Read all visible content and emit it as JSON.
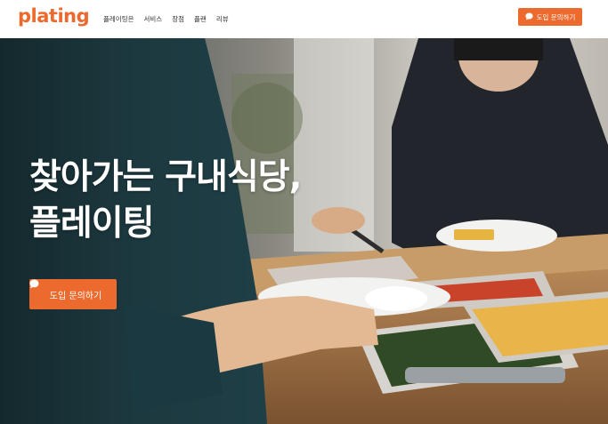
{
  "header": {
    "logo": "plating",
    "nav": [
      {
        "label": "플레이팅은"
      },
      {
        "label": "서비스"
      },
      {
        "label": "장점"
      },
      {
        "label": "플랜"
      },
      {
        "label": "리뷰"
      }
    ],
    "cta_label": "도입 문의하기"
  },
  "hero": {
    "title_line1": "찾아가는 구내식당,",
    "title_line2": "플레이팅",
    "cta_label": "도입 문의하기"
  },
  "colors": {
    "accent": "#ec6a2d",
    "header_bg": "#ffffff",
    "nav_text": "#333333",
    "hero_text": "#ffffff"
  },
  "icons": {
    "cta_icon": "chat-bubble-icon"
  }
}
